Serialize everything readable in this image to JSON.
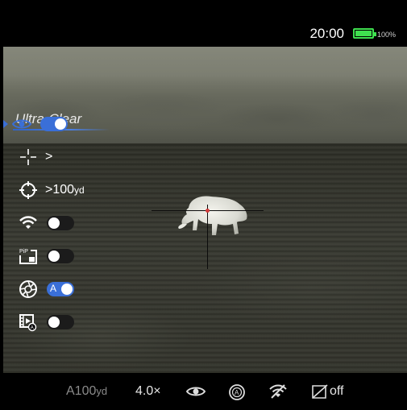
{
  "status": {
    "time": "20:00",
    "battery_pct": "100%",
    "battery_level": 1.0,
    "battery_color": "#3fe04f"
  },
  "menu": {
    "title": "Ultra-Clear",
    "accent_color": "#3a6fd8",
    "items": [
      {
        "icon": "eye-icon",
        "control": "toggle",
        "state": "on",
        "selected": true
      },
      {
        "icon": "crosshair-icon",
        "control": "chevron",
        "chevron": ">"
      },
      {
        "icon": "target-reticle-icon",
        "control": "value",
        "chevron": ">",
        "value": "100",
        "unit": "yd"
      },
      {
        "icon": "wifi-icon",
        "control": "toggle",
        "state": "off"
      },
      {
        "icon": "pip-icon",
        "icon_label": "PiP",
        "control": "toggle",
        "state": "off"
      },
      {
        "icon": "aperture-icon",
        "control": "toggle",
        "state": "auto",
        "toggle_label": "A"
      },
      {
        "icon": "video-record-icon",
        "control": "toggle",
        "state": "off"
      }
    ]
  },
  "bottom_bar": {
    "range_prefix": "A100",
    "range_unit": "yd",
    "zoom": "4.0×",
    "mode_icon": "eye-icon",
    "auto_icon": "auto-aperture-icon",
    "wifi_icon": "wifi-off-icon",
    "record_icon": "record-off-icon",
    "record_state": "off"
  }
}
